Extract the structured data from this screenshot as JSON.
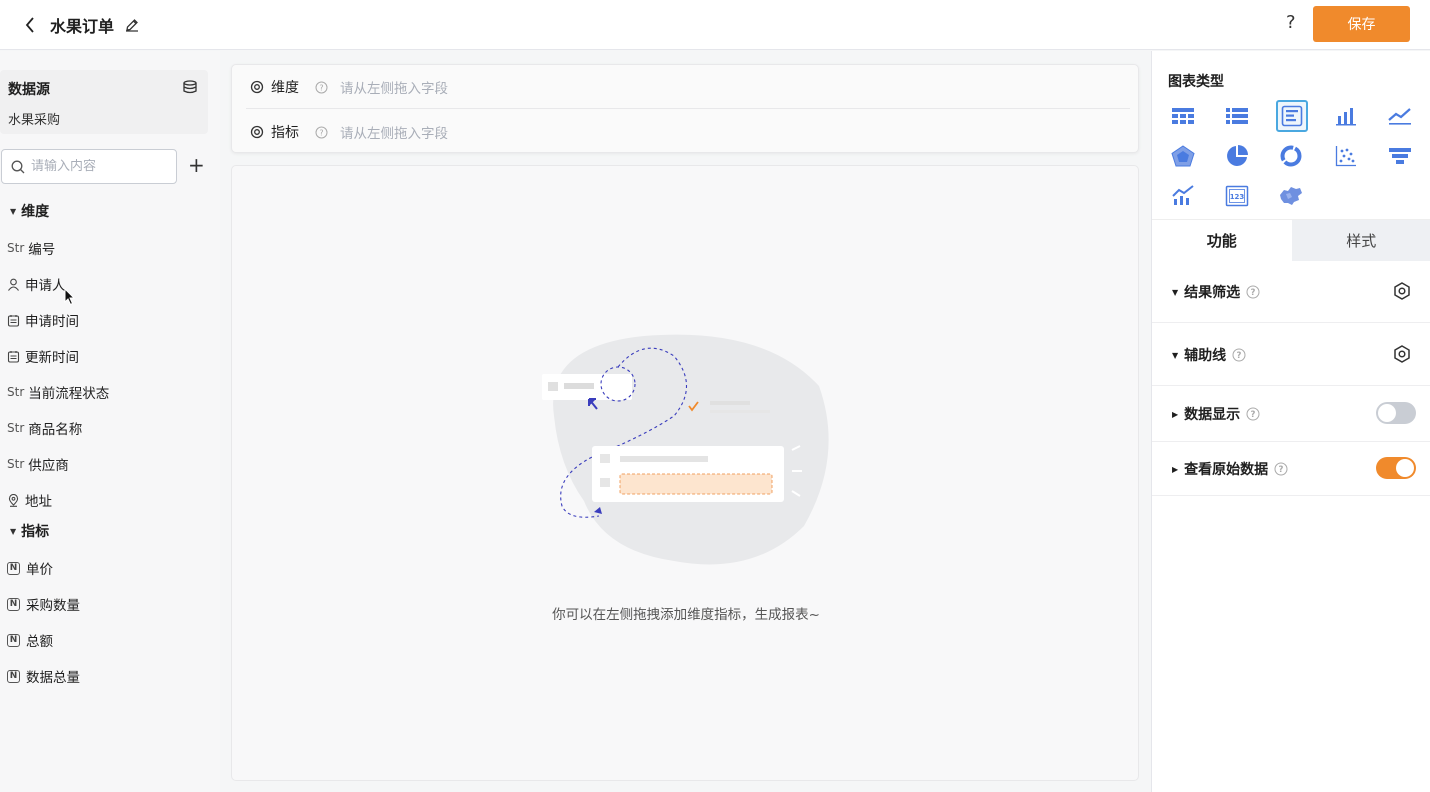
{
  "header": {
    "title": "水果订单",
    "help": "?",
    "save_label": "保存"
  },
  "datasource": {
    "title": "数据源",
    "name": "水果采购"
  },
  "search": {
    "placeholder": "请输入内容"
  },
  "add": "+",
  "dimensions": {
    "title": "维度",
    "items": [
      {
        "type": "Str",
        "label": "编号",
        "icon": "str"
      },
      {
        "type": "",
        "label": "申请人",
        "icon": "person-icon"
      },
      {
        "type": "",
        "label": "申请时间",
        "icon": "calendar-icon"
      },
      {
        "type": "",
        "label": "更新时间",
        "icon": "calendar-icon"
      },
      {
        "type": "Str",
        "label": "当前流程状态",
        "icon": "str"
      },
      {
        "type": "Str",
        "label": "商品名称",
        "icon": "str"
      },
      {
        "type": "Str",
        "label": "供应商",
        "icon": "str"
      },
      {
        "type": "",
        "label": "地址",
        "icon": "location-icon"
      }
    ]
  },
  "metrics": {
    "title": "指标",
    "badge": "N",
    "items": [
      {
        "label": "单价"
      },
      {
        "label": "采购数量"
      },
      {
        "label": "总额"
      },
      {
        "label": "数据总量"
      }
    ]
  },
  "config": {
    "dimension_label": "维度",
    "metric_label": "指标",
    "dimension_placeholder": "请从左侧拖入字段",
    "metric_placeholder": "请从左侧拖入字段"
  },
  "canvas": {
    "empty_text": "你可以在左侧拖拽添加维度指标，生成报表~"
  },
  "right": {
    "chart_type_title": "图表类型",
    "chart_types": [
      "table-icon",
      "list-icon",
      "detail-table-icon",
      "bar-chart-icon",
      "line-chart-icon",
      "radar-chart-icon",
      "pie-chart-icon",
      "donut-chart-icon",
      "scatter-chart-icon",
      "funnel-chart-icon",
      "combo-chart-icon",
      "indicator-card-icon",
      "map-chart-icon"
    ],
    "selected_chart_type": "detail-table-icon",
    "tabs": {
      "function": "功能",
      "style": "样式"
    },
    "options": [
      {
        "label": "结果筛选",
        "control": "gear"
      },
      {
        "label": "辅助线",
        "control": "gear"
      },
      {
        "label": "数据显示",
        "control": "toggle",
        "on": false
      },
      {
        "label": "查看原始数据",
        "control": "toggle",
        "on": true
      }
    ]
  },
  "colors": {
    "accent": "#f08a2c",
    "chart_icon": "#4a7be0",
    "selected_border": "#4aa8e0"
  }
}
